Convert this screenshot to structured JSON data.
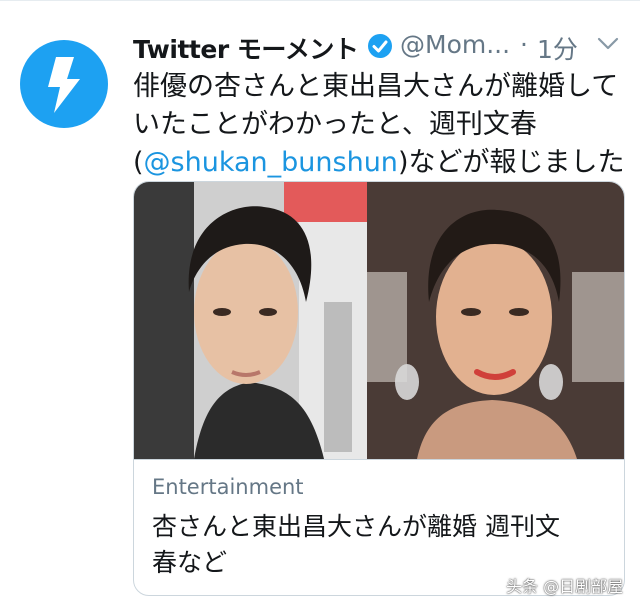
{
  "tweet": {
    "author_name": "Twitter モーメント",
    "handle": "@Mom...",
    "separator": "·",
    "time": "1分",
    "text_lines": [
      "俳優の杏さんと東出昌大さんが離婚して",
      "いたことがわかったと、週刊文春"
    ],
    "text_line3_open": "(",
    "mention": "@shukan_bunshun",
    "text_line3_rest": ")などが報じました"
  },
  "card": {
    "category": "Entertainment",
    "title_lines": [
      "杏さんと東出昌大さんが離婚 週刊文",
      "春など"
    ]
  },
  "watermark": "头条 @日剧部屋",
  "colors": {
    "brand_blue": "#1da1f2",
    "link_blue": "#1b95e0",
    "secondary_text": "#657786",
    "border": "#ccd6dd"
  },
  "icons": {
    "avatar": "lightning-bolt-icon",
    "verified": "verified-badge-icon",
    "menu": "chevron-down-icon"
  }
}
